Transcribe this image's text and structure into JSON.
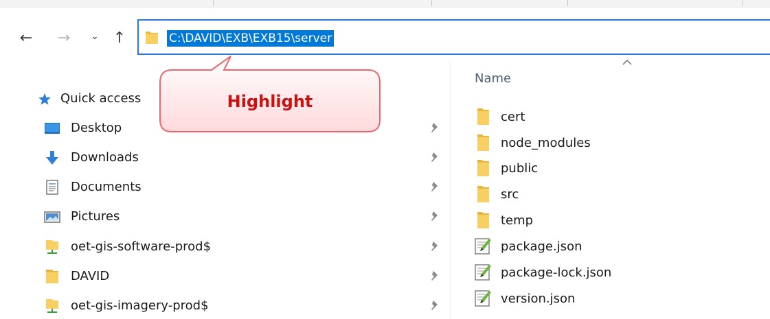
{
  "nav": {
    "back_icon": "arrow-left-icon",
    "forward_icon": "arrow-right-icon",
    "recent_icon": "chevron-down-icon",
    "up_icon": "arrow-up-icon",
    "back_glyph": "←",
    "forward_glyph": "→",
    "recent_glyph": "⌄",
    "up_glyph": "↑"
  },
  "address": {
    "path": "C:\\DAVID\\EXB\\EXB15\\server",
    "selection_color": "#0078d7",
    "border_color": "#2b78d6"
  },
  "callout": {
    "text": "Highlight",
    "text_color": "#cc1111",
    "fill_color": "#ffe9ea",
    "border_color": "#e8686d"
  },
  "sidebar": {
    "quick_access": {
      "label": "Quick access",
      "icon": "star-icon"
    },
    "items": [
      {
        "label": "Desktop",
        "icon": "desktop-icon",
        "pinned": true
      },
      {
        "label": "Downloads",
        "icon": "download-arrow-icon",
        "pinned": true
      },
      {
        "label": "Documents",
        "icon": "documents-icon",
        "pinned": true
      },
      {
        "label": "Pictures",
        "icon": "pictures-icon",
        "pinned": true
      },
      {
        "label": "oet-gis-software-prod$",
        "icon": "network-drive-icon",
        "pinned": true
      },
      {
        "label": "DAVID",
        "icon": "folder-icon",
        "pinned": true
      },
      {
        "label": "oet-gis-imagery-prod$",
        "icon": "network-drive-icon",
        "pinned": true
      }
    ]
  },
  "content": {
    "column_header": "Name",
    "sort": "ascending",
    "files": [
      {
        "name": "cert",
        "type": "folder"
      },
      {
        "name": "node_modules",
        "type": "folder"
      },
      {
        "name": "public",
        "type": "folder"
      },
      {
        "name": "src",
        "type": "folder"
      },
      {
        "name": "temp",
        "type": "folder"
      },
      {
        "name": "package.json",
        "type": "json-file"
      },
      {
        "name": "package-lock.json",
        "type": "json-file"
      },
      {
        "name": "version.json",
        "type": "json-file"
      }
    ]
  },
  "colors": {
    "folder": "#f7cf63",
    "folder_dark": "#e8b53f",
    "accent": "#0078d7"
  }
}
